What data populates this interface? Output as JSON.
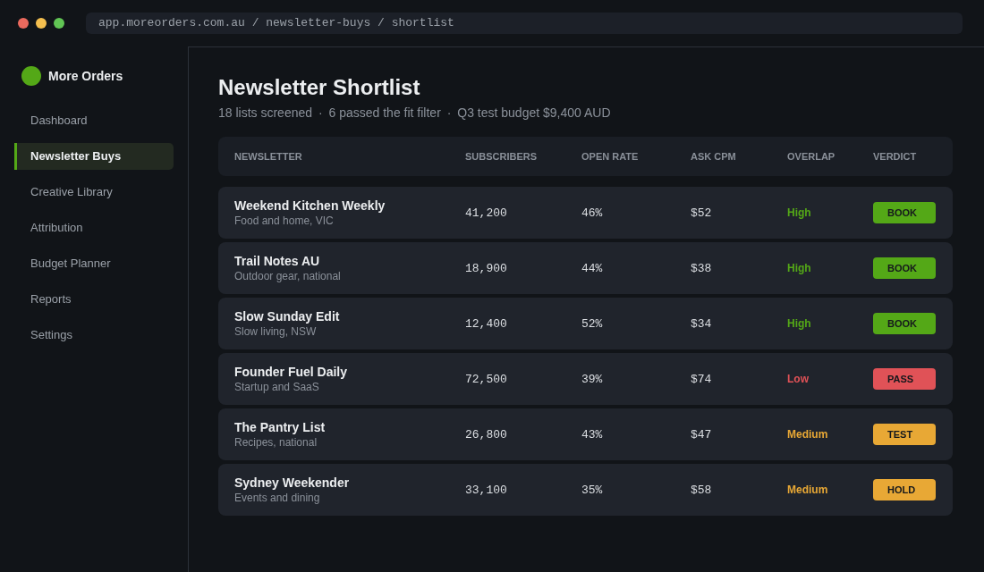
{
  "address_bar": {
    "url": "app.moreorders.com.au / newsletter-buys / shortlist"
  },
  "sidebar": {
    "brand": "More Orders",
    "items": [
      {
        "label": "Dashboard",
        "selected": false
      },
      {
        "label": "Newsletter Buys",
        "selected": true
      },
      {
        "label": "Creative Library",
        "selected": false
      },
      {
        "label": "Attribution",
        "selected": false
      },
      {
        "label": "Budget Planner",
        "selected": false
      },
      {
        "label": "Reports",
        "selected": false
      },
      {
        "label": "Settings",
        "selected": false
      }
    ]
  },
  "page": {
    "title": "Newsletter Shortlist",
    "summary": [
      "18 lists screened",
      "6 passed the fit filter",
      "Q3 test budget $9,400 AUD"
    ],
    "summary_separators": [
      "·",
      "·"
    ]
  },
  "table": {
    "columns": [
      "NEWSLETTER",
      "SUBSCRIBERS",
      "OPEN RATE",
      "ASK CPM",
      "OVERLAP",
      "VERDICT"
    ],
    "rows": [
      {
        "name": "Weekend Kitchen Weekly",
        "description": "Food and home, VIC",
        "subscribers": "41,200",
        "open_rate": "46%",
        "ask_cpm": "$52",
        "overlap": {
          "label": "High",
          "color": "#54a817"
        },
        "verdict": {
          "label": "BOOK",
          "color": "#54a817"
        }
      },
      {
        "name": "Trail Notes AU",
        "description": "Outdoor gear, national",
        "subscribers": "18,900",
        "open_rate": "44%",
        "ask_cpm": "$38",
        "overlap": {
          "label": "High",
          "color": "#54a817"
        },
        "verdict": {
          "label": "BOOK",
          "color": "#54a817"
        }
      },
      {
        "name": "Slow Sunday Edit",
        "description": "Slow living, NSW",
        "subscribers": "12,400",
        "open_rate": "52%",
        "ask_cpm": "$34",
        "overlap": {
          "label": "High",
          "color": "#54a817"
        },
        "verdict": {
          "label": "BOOK",
          "color": "#54a817"
        }
      },
      {
        "name": "Founder Fuel Daily",
        "description": "Startup and SaaS",
        "subscribers": "72,500",
        "open_rate": "39%",
        "ask_cpm": "$74",
        "overlap": {
          "label": "Low",
          "color": "#e05257"
        },
        "verdict": {
          "label": "PASS",
          "color": "#e05257"
        }
      },
      {
        "name": "The Pantry List",
        "description": "Recipes, national",
        "subscribers": "26,800",
        "open_rate": "43%",
        "ask_cpm": "$47",
        "overlap": {
          "label": "Medium",
          "color": "#e8a835"
        },
        "verdict": {
          "label": "TEST",
          "color": "#e8a835"
        }
      },
      {
        "name": "Sydney Weekender",
        "description": "Events and dining",
        "subscribers": "33,100",
        "open_rate": "35%",
        "ask_cpm": "$58",
        "overlap": {
          "label": "Medium",
          "color": "#e8a835"
        },
        "verdict": {
          "label": "HOLD",
          "color": "#e8a835"
        }
      }
    ]
  }
}
